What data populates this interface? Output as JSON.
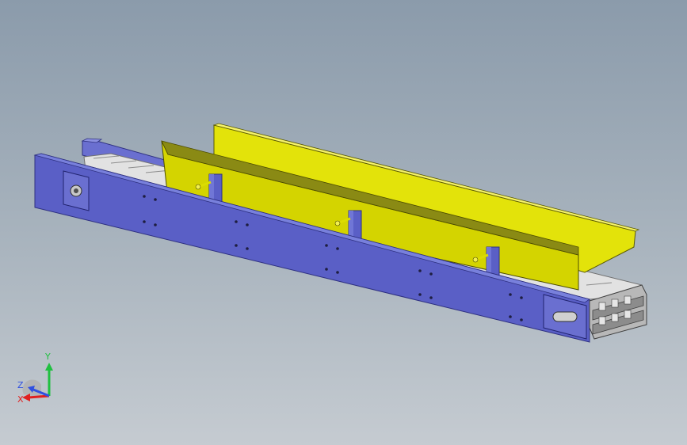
{
  "viewport": {
    "background_top": "#8b9bab",
    "background_bottom": "#c5cbd1"
  },
  "colors": {
    "frame_blue": "#5a5fc6",
    "frame_blue_dark": "#3c3f99",
    "frame_blue_light": "#7076d6",
    "guard_yellow": "#dcdc00",
    "guard_yellow_light": "#f2f050",
    "guard_olive": "#8a8a14",
    "chain_light": "#e6e6e6",
    "chain_dark": "#8c8c8c",
    "axis_x": "#e02020",
    "axis_y": "#20c040",
    "axis_z": "#3050e0"
  },
  "triad": {
    "x_label": "X",
    "y_label": "Y",
    "z_label": "Z"
  }
}
